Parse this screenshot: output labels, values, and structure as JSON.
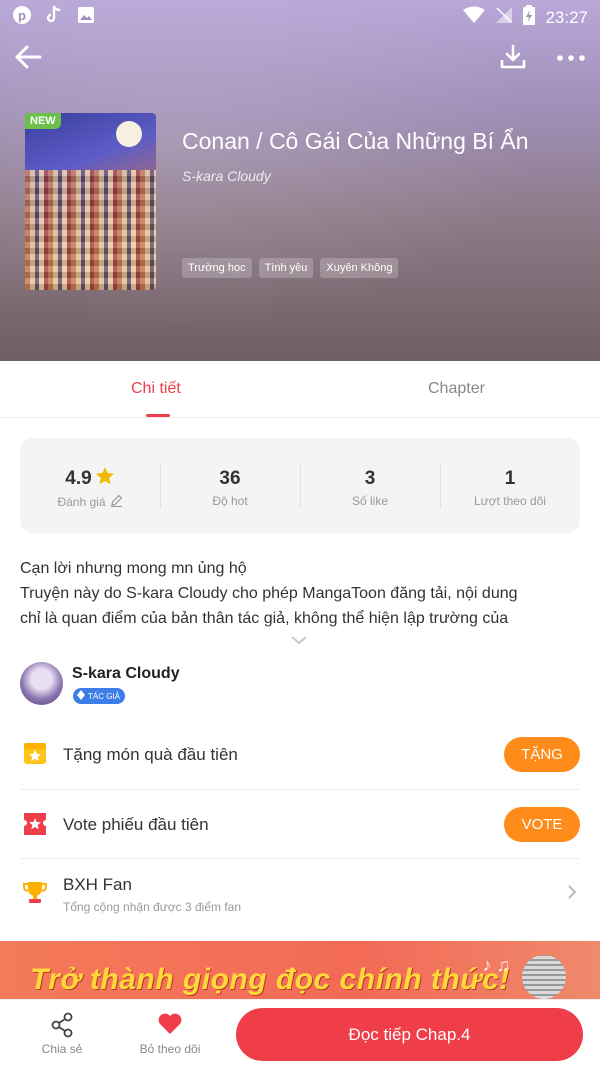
{
  "status_bar": {
    "time": "23:27"
  },
  "book": {
    "title": "Conan / Cô Gái Của Những Bí Ẩn",
    "author": "S-kara Cloudy",
    "badge": "NEW",
    "tags": [
      "Trường học",
      "Tình yêu",
      "Xuyên Không"
    ]
  },
  "tabs": [
    {
      "label": "Chi tiết",
      "active": true
    },
    {
      "label": "Chapter",
      "active": false
    }
  ],
  "stats": [
    {
      "value": "4.9",
      "label": "Đánh giá"
    },
    {
      "value": "36",
      "label": "Độ hot"
    },
    {
      "value": "3",
      "label": "Số like"
    },
    {
      "value": "1",
      "label": "Lượt theo dõi"
    }
  ],
  "description": {
    "line1": "Cạn lời nhưng mong mn ủng hộ",
    "line2": "Truyện này do S-kara Cloudy cho phép MangaToon đăng tải, nội dung",
    "line3": "chỉ là quan điểm của bản thân tác giả, không thể hiện lập trường của"
  },
  "author_block": {
    "name": "S-kara Cloudy",
    "badge": "TÁC GIẢ"
  },
  "actions": {
    "gift": {
      "label": "Tặng món quà đầu tiên",
      "button": "TẶNG"
    },
    "vote": {
      "label": "Vote phiếu đầu tiên",
      "button": "VOTE"
    },
    "fan": {
      "label": "BXH Fan",
      "sub": "Tổng cộng nhận được 3 điểm fan"
    }
  },
  "banner": {
    "text": "Trở thành giọng đọc chính thức!"
  },
  "bottom_bar": {
    "share": "Chia sẻ",
    "unfollow": "Bỏ theo dõi",
    "read": "Đọc tiếp Chap.4"
  },
  "colors": {
    "accent": "#ef3e4a",
    "orange": "#ff8c1a",
    "star": "#f5b800"
  }
}
